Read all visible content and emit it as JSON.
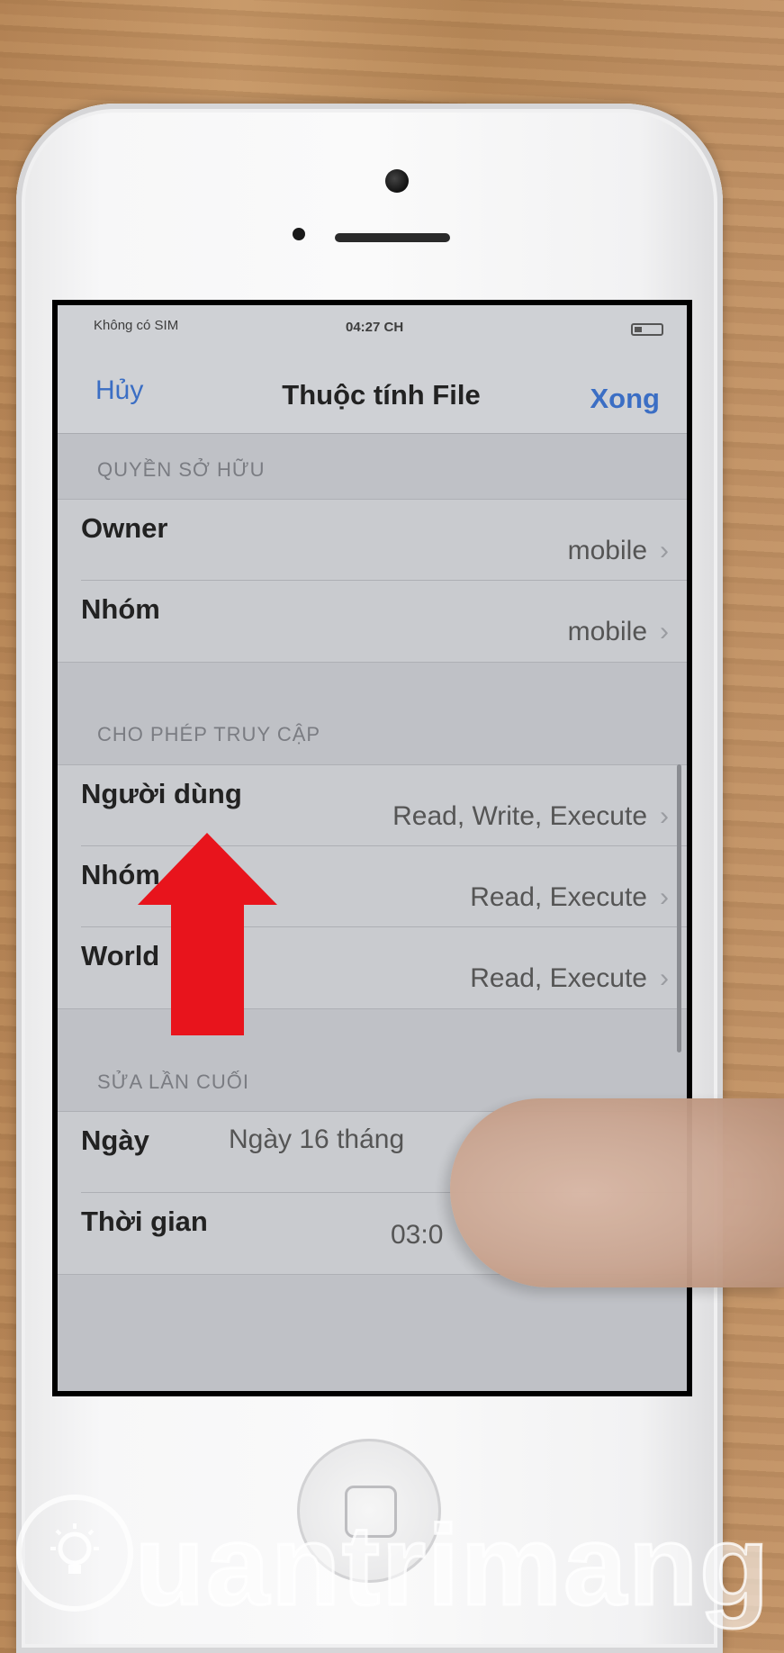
{
  "status_bar": {
    "carrier": "Không có SIM",
    "time": "04:27 CH"
  },
  "nav": {
    "cancel_label": "Hủy",
    "title": "Thuộc tính File",
    "done_label": "Xong"
  },
  "sections": {
    "ownership": {
      "header": "QUYỀN SỞ HỮU",
      "rows": [
        {
          "label": "Owner",
          "value": "mobile"
        },
        {
          "label": "Nhóm",
          "value": "mobile"
        }
      ]
    },
    "access": {
      "header": "CHO PHÉP TRUY CẬP",
      "rows": [
        {
          "label": "Người dùng",
          "value": "Read, Write, Execute"
        },
        {
          "label": "Nhóm",
          "value": "Read, Execute"
        },
        {
          "label": "World",
          "value": "Read, Execute"
        }
      ]
    },
    "modified": {
      "header": "SỬA LẦN CUỐI",
      "rows": [
        {
          "label": "Ngày",
          "value": "Ngày 16 tháng"
        },
        {
          "label": "Thời gian",
          "value": "03:0"
        }
      ]
    }
  },
  "chevron": "›",
  "watermark": {
    "text": "uantrimang",
    "icon": "lightbulb-icon"
  },
  "colors": {
    "accent": "#3b6ec4",
    "arrow": "#e8141c"
  }
}
